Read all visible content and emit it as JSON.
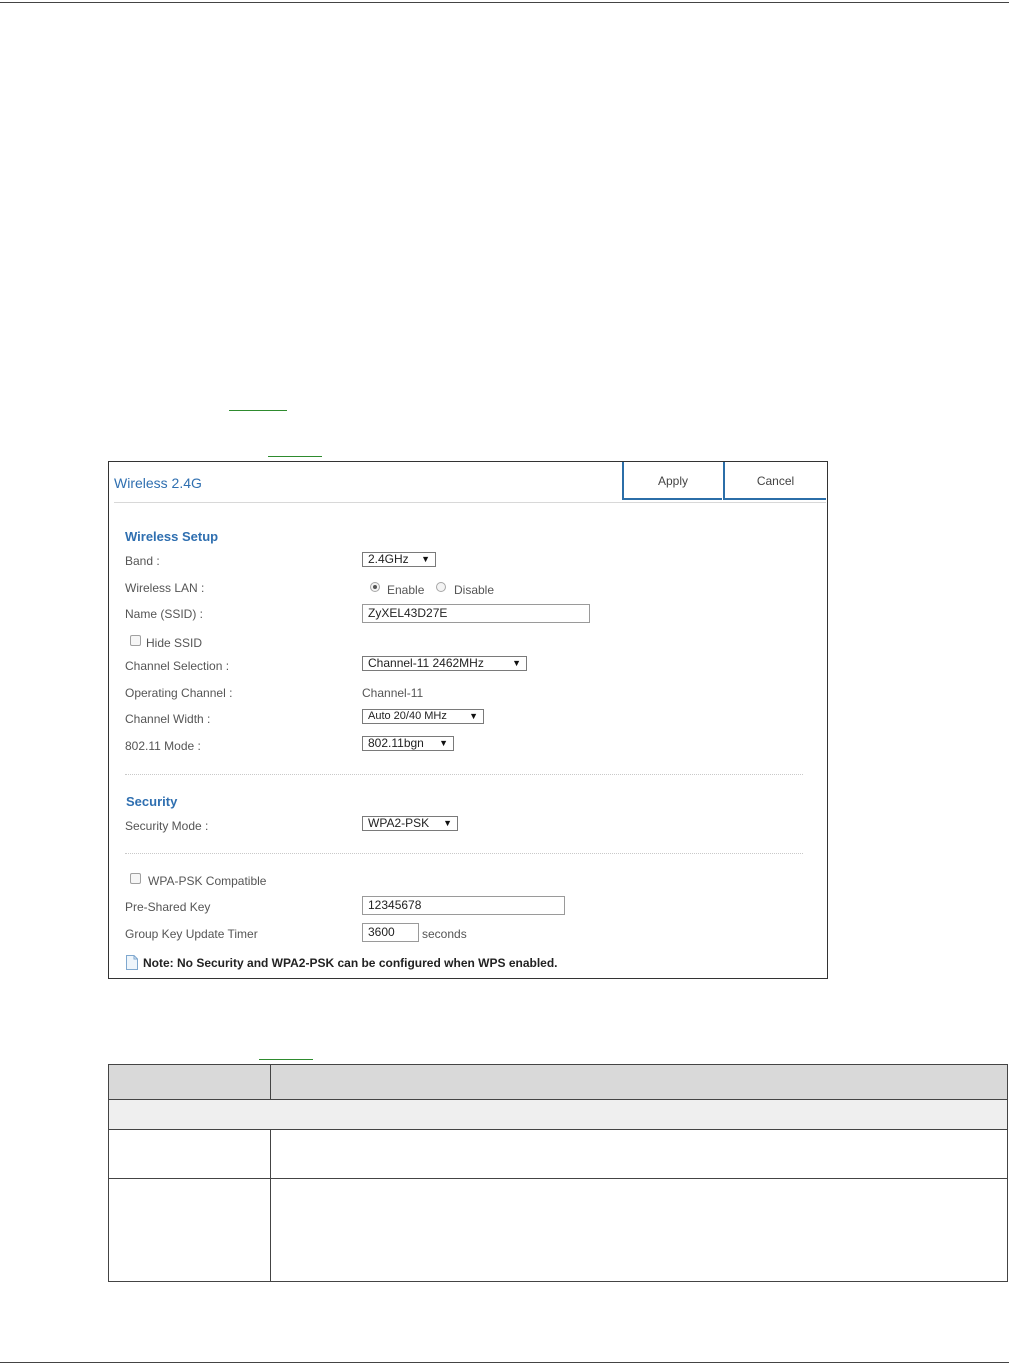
{
  "dialog": {
    "title": "Wireless 2.4G",
    "apply_label": "Apply",
    "cancel_label": "Cancel"
  },
  "wireless_setup": {
    "section_title": "Wireless Setup",
    "band": {
      "label": "Band :",
      "value": "2.4GHz"
    },
    "wireless_lan": {
      "label": "Wireless LAN :",
      "enable_label": "Enable",
      "disable_label": "Disable",
      "selected": "Enable"
    },
    "ssid": {
      "label": "Name (SSID) :",
      "value": "ZyXEL43D27E"
    },
    "hide_ssid": {
      "label": "Hide SSID",
      "checked": false
    },
    "channel_selection": {
      "label": "Channel Selection :",
      "value": "Channel-11 2462MHz"
    },
    "operating_channel": {
      "label": "Operating Channel :",
      "value": "Channel-11"
    },
    "channel_width": {
      "label": "Channel Width :",
      "value": "Auto 20/40 MHz"
    },
    "mode": {
      "label": "802.11 Mode :",
      "value": "802.11bgn"
    }
  },
  "security": {
    "section_title": "Security",
    "security_mode": {
      "label": "Security Mode :",
      "value": "WPA2-PSK"
    },
    "wpa_psk_compatible": {
      "label": "WPA-PSK Compatible",
      "checked": false
    },
    "pre_shared_key": {
      "label": "Pre-Shared Key",
      "value": "12345678"
    },
    "group_key_timer": {
      "label": "Group Key Update Timer",
      "value": "3600",
      "unit": "seconds"
    },
    "note": "Note: No Security and WPA2-PSK can be configured when WPS enabled."
  },
  "colors": {
    "accent": "#2f6fb0",
    "button_border": "#2b6ea8",
    "link_underline": "#2e8b2e",
    "table_header": "#d9d9d9"
  }
}
